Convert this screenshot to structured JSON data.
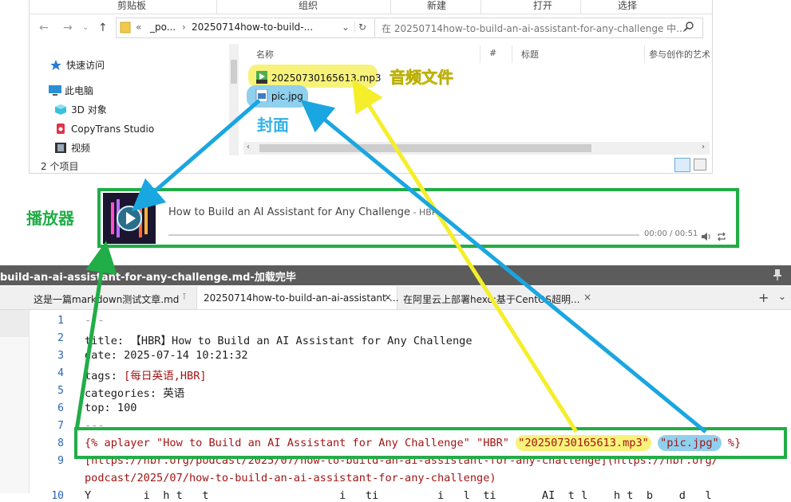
{
  "explorer": {
    "ribbon": [
      "剪贴板",
      "组织",
      "新建",
      "打开",
      "选择"
    ],
    "address": {
      "chev": "«",
      "part1": "_po...",
      "arrow": "›",
      "part2": "20250714how-to-build-...",
      "dropdown": "⌄",
      "refresh": "↻"
    },
    "search_placeholder": "在 20250714how-to-build-an-ai-assistant-for-any-challenge 中...",
    "nav_buttons": {
      "back": "←",
      "forward": "→",
      "recent": "⌄",
      "up": "↑"
    },
    "nav_items": [
      {
        "label": "快速访问",
        "icon": "star-icon"
      },
      {
        "label": "此电脑",
        "icon": "computer-icon"
      },
      {
        "label": "3D 对象",
        "icon": "cube-icon"
      },
      {
        "label": "CopyTrans Studio",
        "icon": "copytrans-icon"
      },
      {
        "label": "视频",
        "icon": "video-icon"
      }
    ],
    "columns": [
      "名称",
      "#",
      "标题",
      "参与创作的艺术"
    ],
    "files": [
      {
        "name": "20250730165613.mp3",
        "icon": "mp3-file-icon"
      },
      {
        "name": "pic.jpg",
        "icon": "jpg-file-icon"
      }
    ],
    "status": "2 个项目"
  },
  "annotations": {
    "audio_label": "音频文件",
    "cover_label": "封面",
    "player_label": "播放器",
    "colors": {
      "yellow": "#f7f27a",
      "blue": "#1aa6e0",
      "green": "#21ad47"
    }
  },
  "player": {
    "title": "How to Build an AI Assistant for Any Challenge",
    "separator": " - ",
    "author": "HBR",
    "time": "00:00 / 00:51"
  },
  "editor": {
    "title": "build-an-ai-assistant-for-any-challenge.md-加载完毕",
    "tabs": [
      {
        "label": "这是一篇markdown测试文章.md",
        "active": false
      },
      {
        "label": "20250714how-to-build-an-ai-assistant-...",
        "active": true
      },
      {
        "label": "在阿里云上部署hexo:基于CentOS超明...",
        "active": false
      }
    ],
    "new_tab": "+",
    "line_numbers": [
      "1",
      "2",
      "3",
      "4",
      "5",
      "6",
      "7",
      "8",
      "9",
      "",
      "10"
    ],
    "lines": {
      "l1": "---",
      "l2": "title: 【HBR】How to Build an AI Assistant for Any Challenge",
      "l3": "date: 2025-07-14 10:21:32",
      "l4_key": "tags: ",
      "l4_val": "[每日英语,HBR]",
      "l5": "categories: 英语",
      "l6": "top: 100",
      "l7": "---",
      "l8_a": "{% aplayer \"How to Build an AI Assistant for Any Challenge\" \"HBR\" ",
      "l8_mp3": "\"20250730165613.mp3\"",
      "l8_space": " ",
      "l8_pic": "\"pic.jpg\"",
      "l8_end": " %}",
      "l9a": "[https://hbr.org/podcast/2025/07/how-to-build-an-ai-assistant-for-any-challenge](https://hbr.org/",
      "l9b": "podcast/2025/07/how-to-build-an-ai-assistant-for-any-challenge)",
      "l10": "Y        i  h t   t                    i   ti         i   l  ti       AI  t l    h t  b    d   l"
    }
  }
}
